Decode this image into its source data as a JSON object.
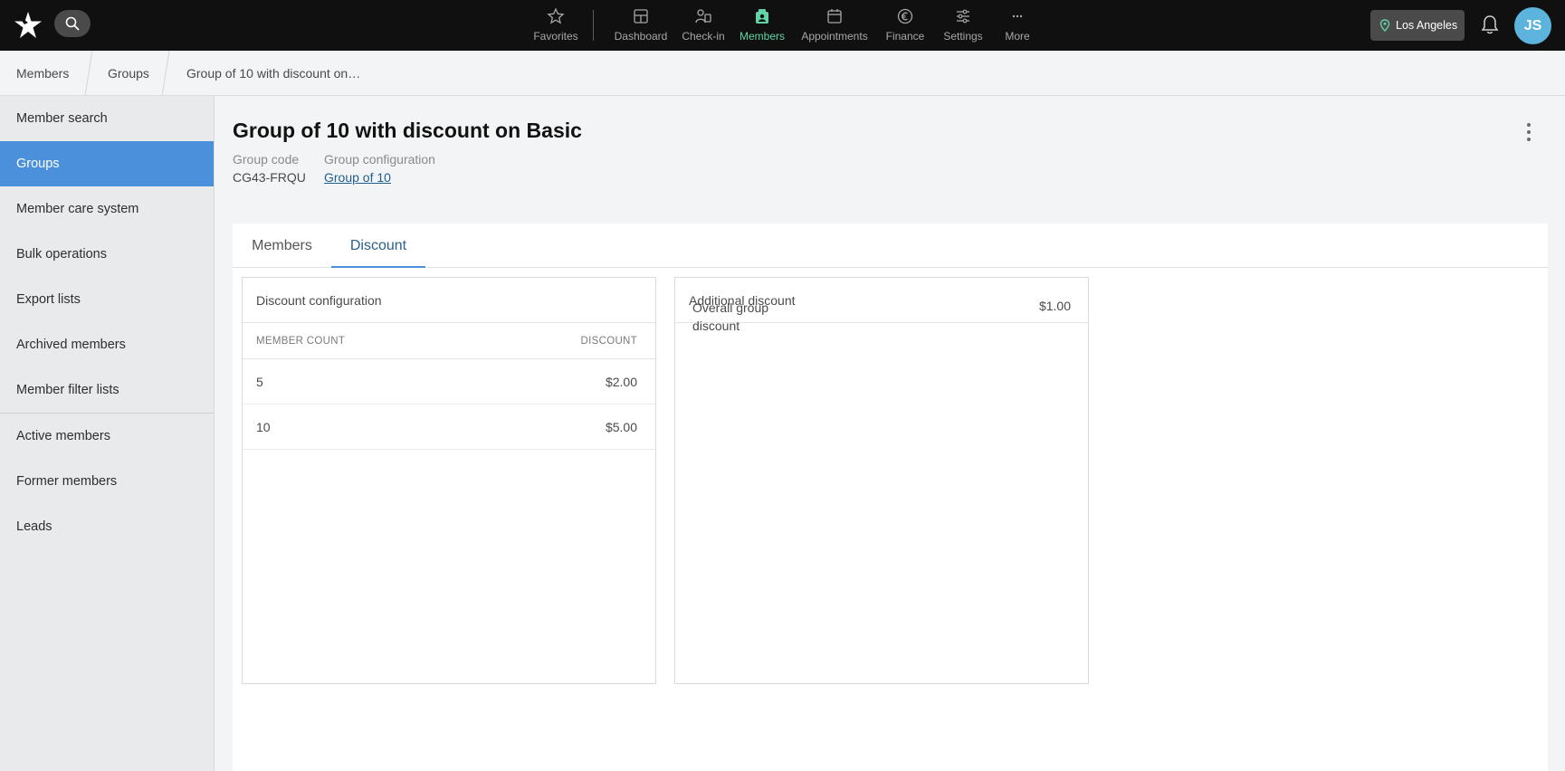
{
  "nav": {
    "items": [
      {
        "label": "Favorites",
        "icon": "star-icon"
      },
      {
        "label": "Dashboard",
        "icon": "dashboard-icon"
      },
      {
        "label": "Check-in",
        "icon": "check-in-icon"
      },
      {
        "label": "Members",
        "icon": "members-icon"
      },
      {
        "label": "Appointments",
        "icon": "calendar-icon"
      },
      {
        "label": "Finance",
        "icon": "euro-icon"
      },
      {
        "label": "Settings",
        "icon": "sliders-icon"
      },
      {
        "label": "More",
        "icon": "ellipsis-icon"
      }
    ],
    "active": "Members",
    "location": "Los Angeles",
    "avatar_initials": "JS"
  },
  "breadcrumb": [
    "Members",
    "Groups",
    "Group of 10 with discount on…"
  ],
  "sidebar": {
    "items": [
      {
        "label": "Member search"
      },
      {
        "label": "Groups"
      },
      {
        "label": "Member care system"
      },
      {
        "label": "Bulk operations"
      },
      {
        "label": "Export lists"
      },
      {
        "label": "Archived members"
      },
      {
        "label": "Member filter lists"
      },
      {
        "label": "Active members"
      },
      {
        "label": "Former members"
      },
      {
        "label": "Leads"
      }
    ],
    "active": "Groups"
  },
  "header": {
    "title": "Group of 10 with discount on Basic",
    "group_code_label": "Group code",
    "group_code": "CG43-FRQU",
    "group_config_label": "Group configuration",
    "group_config": "Group of 10"
  },
  "tabs": [
    {
      "label": "Members"
    },
    {
      "label": "Discount"
    }
  ],
  "active_tab": "Discount",
  "discount_config": {
    "title": "Discount configuration",
    "columns": [
      "MEMBER COUNT",
      "DISCOUNT"
    ],
    "rows": [
      {
        "count": "5",
        "discount": "$2.00"
      },
      {
        "count": "10",
        "discount": "$5.00"
      }
    ]
  },
  "additional_discount": {
    "title": "Additional discount",
    "label": "Overall group discount",
    "value": "$1.00"
  },
  "colors": {
    "topbar": "#101010",
    "accent_active_nav": "#62d3a6",
    "sidebar_active": "#4a90db",
    "link": "#1f5e8c",
    "avatar": "#5cb3dc"
  }
}
